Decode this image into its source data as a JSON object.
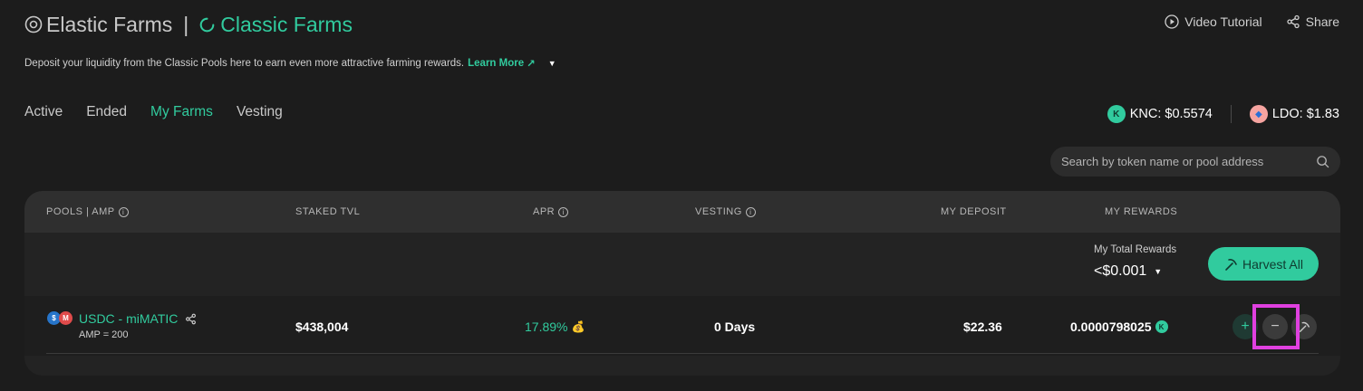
{
  "header": {
    "elastic_title": "Elastic Farms",
    "separator": "|",
    "classic_title": "Classic Farms",
    "video_label": "Video Tutorial",
    "share_label": "Share"
  },
  "subtitle": {
    "text": "Deposit your liquidity from the Classic Pools here to earn even more attractive farming rewards.",
    "learn_more": "Learn More"
  },
  "tabs": [
    {
      "label": "Active"
    },
    {
      "label": "Ended"
    },
    {
      "label": "My Farms"
    },
    {
      "label": "Vesting"
    }
  ],
  "active_tab": "My Farms",
  "prices": {
    "knc": "KNC: $0.5574",
    "ldo": "LDO: $1.83"
  },
  "search": {
    "placeholder": "Search by token name or pool address"
  },
  "table": {
    "headers": {
      "pools": "POOLS | AMP",
      "staked_tvl": "STAKED TVL",
      "apr": "APR",
      "vesting": "VESTING",
      "my_deposit": "MY DEPOSIT",
      "my_rewards": "MY REWARDS"
    },
    "summary": {
      "label": "My Total Rewards",
      "value": "<$0.001",
      "harvest_all": "Harvest All"
    },
    "rows": [
      {
        "pool": "USDC - miMATIC",
        "amp": "AMP = 200",
        "staked_tvl": "$438,004",
        "apr": "17.89%",
        "vesting": "0 Days",
        "my_deposit": "$22.36",
        "my_rewards": "0.0000798025"
      }
    ]
  },
  "colors": {
    "accent": "#31cb9e",
    "background": "#1c1c1c",
    "highlight": "#e040e0"
  }
}
